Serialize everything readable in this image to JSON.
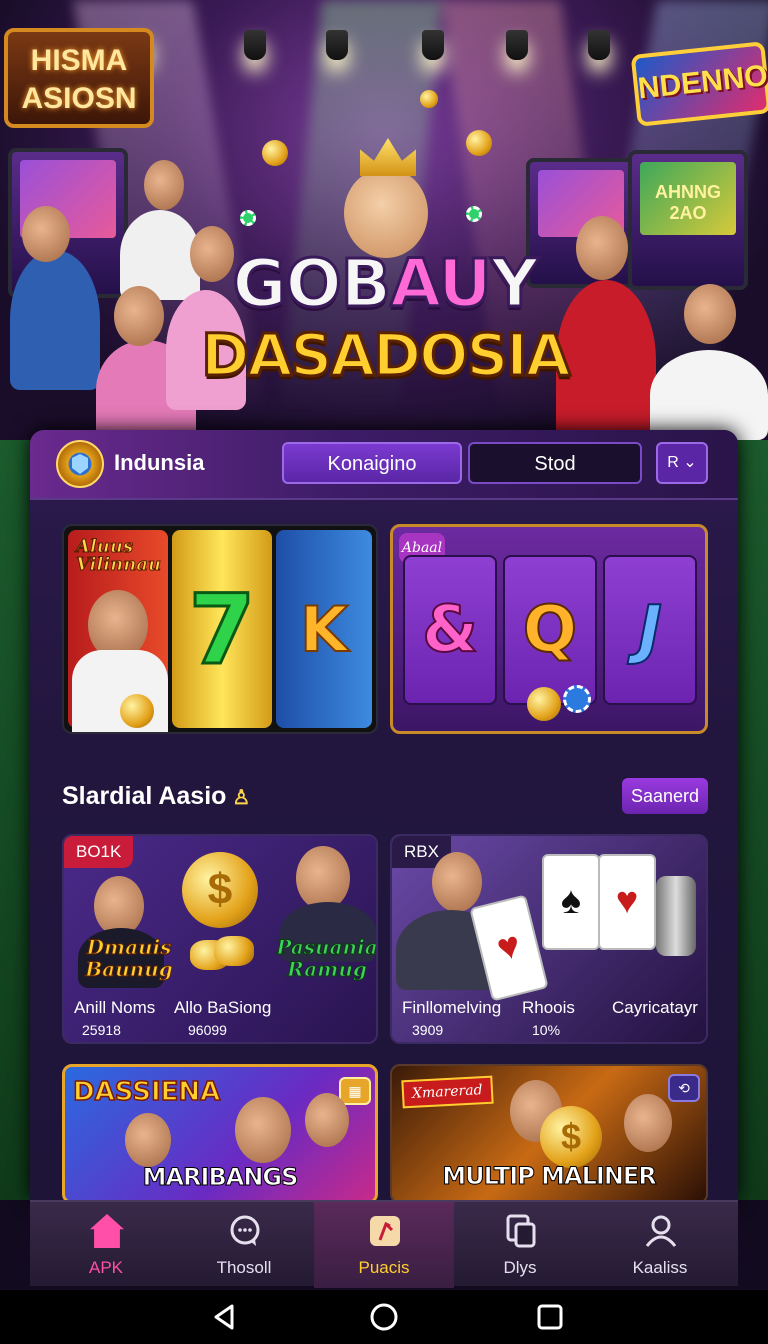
{
  "hero": {
    "sign_left": "HISMA ASIOSN",
    "sign_right": "NDENNO",
    "machine_screen_text": "AHNNG 2AO",
    "logo_line1_part1": "GOB",
    "logo_line1_part2": "AU",
    "logo_line1_part3": "Y",
    "logo_line2": "DASADOSIA"
  },
  "header": {
    "brand": "Indunsia",
    "tabs": [
      "Konaigino",
      "Stod"
    ],
    "lang_label": "R"
  },
  "featured": {
    "reel_a_tag": "Aluus Vilinnau",
    "reel_a_symbols": [
      "7",
      "K"
    ],
    "reel_b_tag": "Abaal",
    "reel_b_symbols": [
      "&",
      "Q",
      "J"
    ]
  },
  "section": {
    "title": "Slardial Aasio",
    "see_all": "Saanerd"
  },
  "games": [
    {
      "badge": "BO1K",
      "promo_left": "Dmauis Baunug",
      "promo_right": "Pasuania Ramug",
      "coin_symbol": "$",
      "labels": [
        "Anill Noms",
        "Allo BaSiong"
      ],
      "numbers": [
        "25918",
        "96099"
      ]
    },
    {
      "badge": "RBX",
      "card_suits": [
        "♥",
        "♠",
        "♥"
      ],
      "labels": [
        "Finllomelving",
        "Rhoois",
        "Cayricatayr"
      ],
      "numbers": [
        "3909",
        "10%"
      ]
    }
  ],
  "tiles": [
    {
      "head": "DASSIENA",
      "name": "MARIBANGS"
    },
    {
      "tag": "Xmarerad",
      "name": "MULTIP MALINER",
      "coin_symbol": "$"
    }
  ],
  "nav": [
    {
      "label": "APK",
      "icon": "home-icon"
    },
    {
      "label": "Thosoll",
      "icon": "chat-icon"
    },
    {
      "label": "Puacis",
      "icon": "card-icon"
    },
    {
      "label": "Dlys",
      "icon": "copy-icon"
    },
    {
      "label": "Kaaliss",
      "icon": "profile-icon"
    }
  ],
  "colors": {
    "accent": "#ff4fa8",
    "panel": "#2c1a4e",
    "tab_active": "#7b3ad0",
    "gold": "#ffcf30"
  }
}
